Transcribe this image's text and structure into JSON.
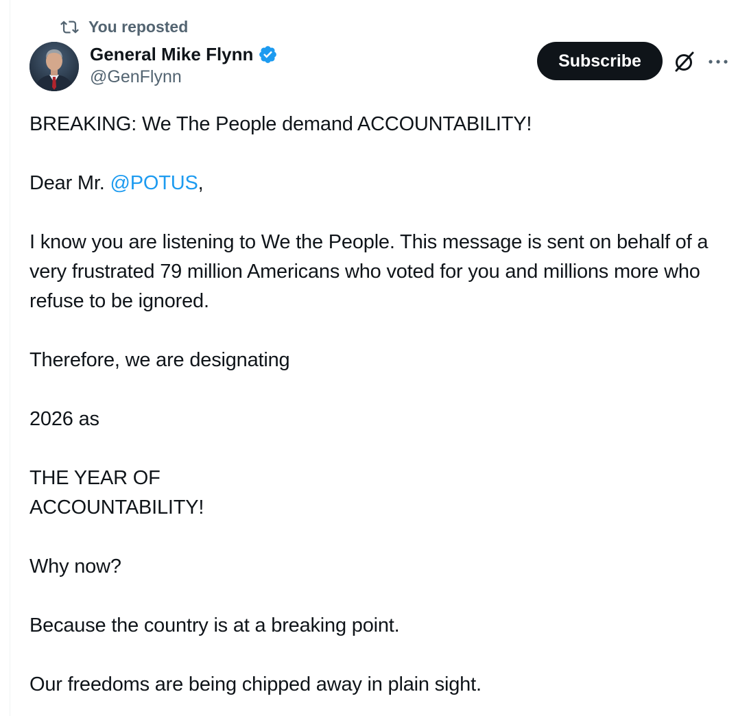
{
  "repost": {
    "label": "You reposted",
    "icon": "repost-icon"
  },
  "author": {
    "name": "General Mike Flynn",
    "handle": "@GenFlynn",
    "verified": true,
    "verified_icon": "verified-badge-icon",
    "verified_color": "#1d9bf0"
  },
  "actions": {
    "subscribe_label": "Subscribe",
    "grok_icon": "grok-icon",
    "more_icon": "more-dots-icon"
  },
  "tweet": {
    "headline": "BREAKING: We The People demand ACCOUNTABILITY!",
    "salutation_prefix": "Dear Mr. ",
    "salutation_mention": "@POTUS",
    "salutation_suffix": ",",
    "para1": "I know you are listening to We the People. This message is sent on behalf of a very frustrated 79 million Americans who voted for you and millions more who refuse to be ignored.",
    "para2": "Therefore, we are designating",
    "para3": "2026 as",
    "para4_line1": "THE YEAR OF",
    "para4_line2": "ACCOUNTABILITY!",
    "para5": "Why now?",
    "para6": "Because the country is at a breaking point.",
    "para7": "Our freedoms are being chipped away in plain sight."
  },
  "colors": {
    "text_primary": "#0f1419",
    "text_secondary": "#536471",
    "link": "#1d9bf0",
    "button_bg": "#0f1419"
  }
}
